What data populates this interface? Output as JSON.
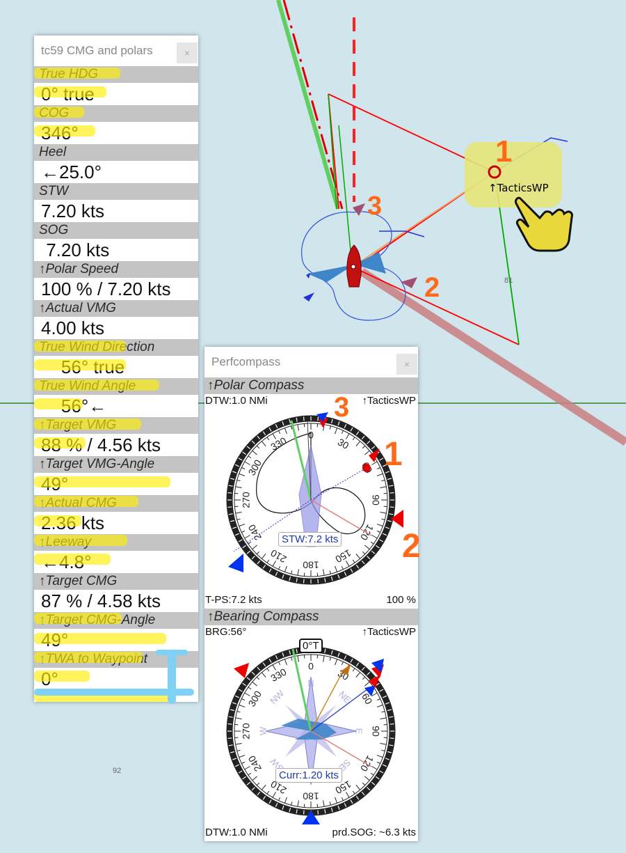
{
  "chart": {
    "waypoint_label": "↑TacticsWP",
    "depth_labels": [
      "81",
      "92"
    ],
    "annotations": [
      "1",
      "2",
      "3"
    ]
  },
  "cmg_panel": {
    "title": "tc59 CMG and polars",
    "close_label": "×",
    "rows": [
      {
        "label": "True HDG",
        "value": "0° true"
      },
      {
        "label": "COG",
        "value": "346°"
      },
      {
        "label": "Heel",
        "value": "←25.0°"
      },
      {
        "label": "STW",
        "value": "7.20 kts"
      },
      {
        "label": "SOG",
        "value": " 7.20 kts"
      },
      {
        "label": "↑Polar Speed",
        "value": "100 % / 7.20 kts"
      },
      {
        "label": "↑Actual VMG",
        "value": "4.00 kts"
      },
      {
        "label": "True Wind Direction",
        "value": "    56° true"
      },
      {
        "label": "True Wind Angle",
        "value": "    56°←"
      },
      {
        "label": "↑Target VMG",
        "value": "88 % / 4.56 kts"
      },
      {
        "label": "↑Target VMG-Angle",
        "value": "49°"
      },
      {
        "label": "↑Actual CMG",
        "value": "2.36 kts"
      },
      {
        "label": "↑Leeway",
        "value": "←4.8°"
      },
      {
        "label": "↑Target CMG",
        "value": "87 % / 4.58 kts"
      },
      {
        "label": "↑Target CMG-Angle",
        "value": "49°"
      },
      {
        "label": "↑TWA to Waypoint",
        "value": "0°"
      }
    ]
  },
  "perf_panel": {
    "title": "Perfcompass",
    "close_label": "×",
    "polar_compass": {
      "header": "↑Polar Compass",
      "top_left": "DTW:1.0 NMi",
      "top_right": "↑TacticsWP",
      "center_label": "STW:7.2 kts",
      "bottom_left": "T-PS:7.2 kts",
      "bottom_right": "100 %",
      "ring_labels": [
        "0",
        "30",
        "60",
        "90",
        "120",
        "150",
        "180",
        "210",
        "240",
        "270",
        "300",
        "330"
      ]
    },
    "bearing_compass": {
      "header": "↑Bearing Compass",
      "top_left": "BRG:56°",
      "top_right": "↑TacticsWP",
      "heading_box": "0°T",
      "center_label": "Curr:1.20 kts",
      "bottom_left": "DTW:1.0 NMi",
      "bottom_right": "prd.SOG: ~6.3 kts",
      "ring_labels": [
        "0",
        "30",
        "60",
        "90",
        "120",
        "150",
        "180",
        "210",
        "240",
        "270",
        "300",
        "330"
      ],
      "cardinals": [
        "N",
        "NE",
        "E",
        "SE",
        "S",
        "SW",
        "W",
        "NW"
      ]
    }
  },
  "colors": {
    "sea": "#d1e5ec",
    "highlight": "#ffee00",
    "annotation": "#ff6a1a",
    "route": "#ff0000",
    "accent_blue": "#0000ff"
  }
}
